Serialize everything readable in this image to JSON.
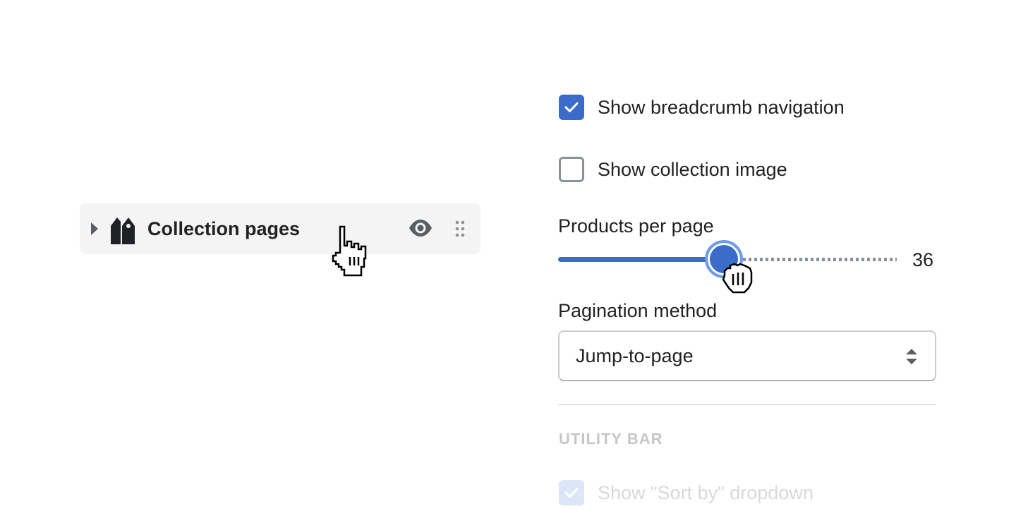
{
  "sections": {
    "collection_row": {
      "label": "Collection pages",
      "icons": [
        "caret-right-icon",
        "tag-icon",
        "eye-icon",
        "drag-handle-icon"
      ]
    }
  },
  "settings": {
    "breadcrumb": {
      "label": "Show breadcrumb navigation",
      "checked": true
    },
    "collection_image": {
      "label": "Show collection image",
      "checked": false
    },
    "products_per_page": {
      "label": "Products per page",
      "value": "36",
      "fraction": 0.49
    },
    "pagination": {
      "label": "Pagination method",
      "value": "Jump-to-page"
    },
    "utility_bar": {
      "heading": "UTILITY BAR",
      "sort_by": {
        "label": "Show \"Sort by\" dropdown",
        "checked": true
      }
    }
  },
  "colors": {
    "accent": "#3b6cc9",
    "row_background": "#f4f4f4",
    "disabled_text": "#d7d9db"
  },
  "cursors": [
    "pointer-hand-icon",
    "grab-hand-icon"
  ]
}
